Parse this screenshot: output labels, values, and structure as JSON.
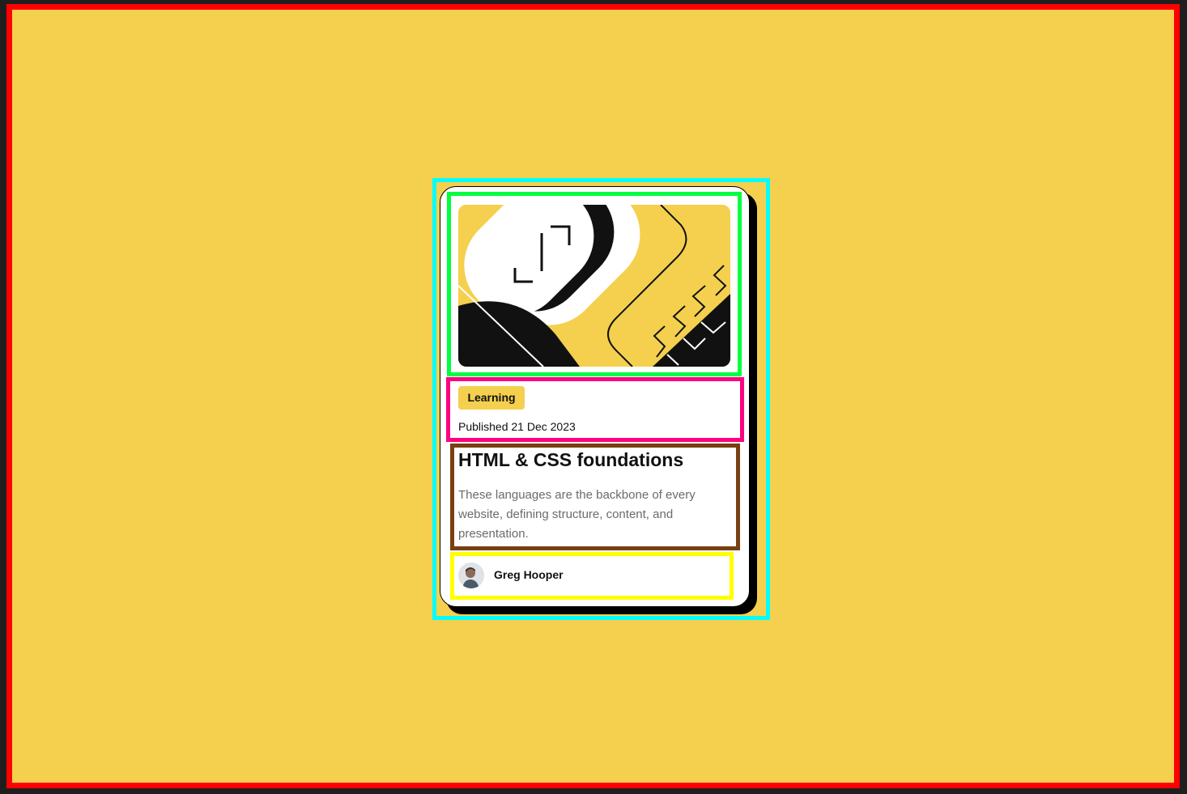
{
  "colors": {
    "page_background": "#f4d04e",
    "card_background": "#ffffff",
    "card_shadow": "#000000",
    "tag_background": "#f4d04e",
    "description_text": "#6b6b6b"
  },
  "card": {
    "image_icon": "abstract-illustration-icon",
    "tag": "Learning",
    "published": "Published 21 Dec 2023",
    "title": "HTML & CSS foundations",
    "description": "These languages are the backbone of every website, defining structure, content, and presentation.",
    "author": {
      "name": "Greg Hooper",
      "avatar_icon": "avatar-icon"
    }
  }
}
